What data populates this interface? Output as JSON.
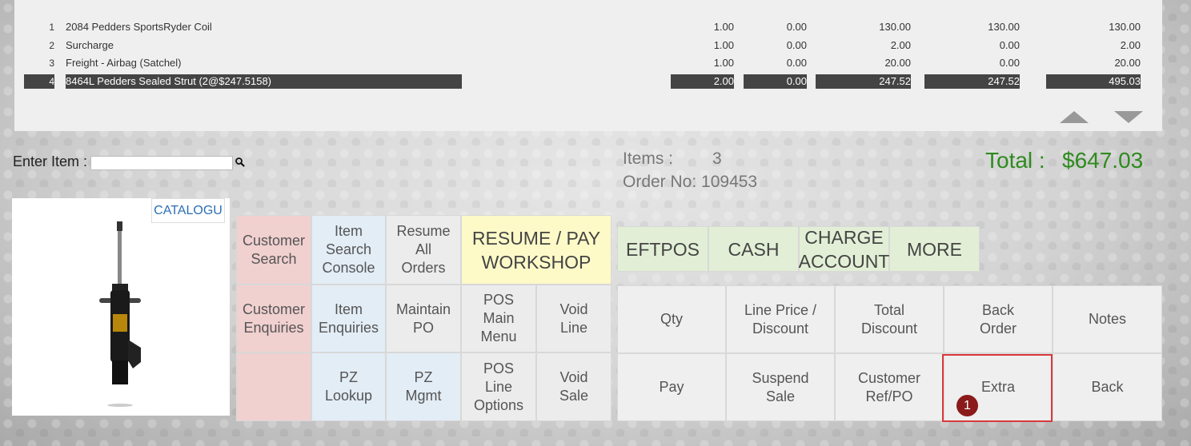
{
  "order_lines": [
    {
      "num": "1",
      "description": "2084 Pedders SportsRyder Coil",
      "qty": "1.00",
      "discount": "0.00",
      "unit_price": "130.00",
      "price": "130.00",
      "total": "130.00"
    },
    {
      "num": "2",
      "description": "Surcharge",
      "qty": "1.00",
      "discount": "0.00",
      "unit_price": "2.00",
      "price": "0.00",
      "total": "2.00"
    },
    {
      "num": "3",
      "description": "Freight - Airbag (Satchel)",
      "qty": "1.00",
      "discount": "0.00",
      "unit_price": "20.00",
      "price": "0.00",
      "total": "20.00"
    },
    {
      "num": "4",
      "description": "8464L Pedders Sealed Strut  (2@$247.5158)",
      "qty": "2.00",
      "discount": "0.00",
      "unit_price": "247.52",
      "price": "247.52",
      "total": "495.03"
    }
  ],
  "entry": {
    "label": "Enter Item :",
    "value": "",
    "search_icon": "magnifier-icon"
  },
  "summary": {
    "items_label": "Items :",
    "items_value": "3",
    "order_label": "Order No: 109453",
    "total_label": "Total :",
    "total_value": "$647.03"
  },
  "catalogue_label": "CATALOGU",
  "left_buttons": {
    "customer_search": "Customer\nSearch",
    "item_search_console": "Item\nSearch\nConsole",
    "resume_all_orders": "Resume\nAll\nOrders",
    "resume_pay_workshop": "RESUME / PAY\nWORKSHOP",
    "customer_enquiries": "Customer\nEnquiries",
    "item_enquiries": "Item\nEnquiries",
    "maintain_po": "Maintain\nPO",
    "pos_main_menu": "POS\nMain\nMenu",
    "void_line": "Void\nLine",
    "pz_lookup": "PZ\nLookup",
    "pz_mgmt": "PZ\nMgmt",
    "pos_line_options": "POS\nLine\nOptions",
    "void_sale": "Void\nSale"
  },
  "payment_buttons": {
    "eftpos": "EFTPOS",
    "cash": "CASH",
    "charge_account": "CHARGE\nACCOUNT",
    "more": "MORE"
  },
  "function_buttons": {
    "qty": "Qty",
    "line_price_discount": "Line Price /\nDiscount",
    "total_discount": "Total\nDiscount",
    "back_order": "Back\nOrder",
    "notes": "Notes",
    "pay": "Pay",
    "suspend_sale": "Suspend\nSale",
    "customer_ref_po": "Customer\nRef/PO",
    "extra": "Extra",
    "back": "Back"
  },
  "step_badge": "1",
  "colors": {
    "total": "#2e8b1e",
    "highlight": "#d9393c",
    "badge": "#8b1a1a",
    "selected_row": "#444444"
  }
}
